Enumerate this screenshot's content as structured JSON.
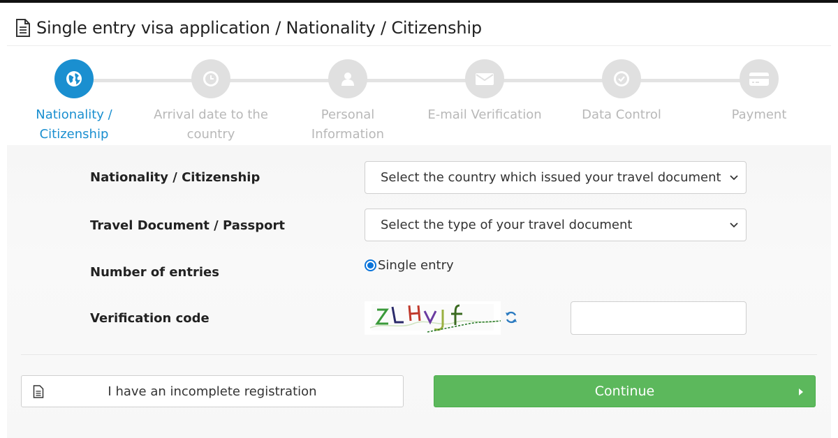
{
  "header": {
    "title": "Single entry visa application / Nationality / Citizenship",
    "icon": "document-icon"
  },
  "stepper": {
    "active_color": "#1a8fd0",
    "inactive_color": "#e0e0e0",
    "steps": [
      {
        "label": "Nationality / Citizenship",
        "icon": "globe-icon",
        "active": true
      },
      {
        "label": "Arrival date to the country",
        "icon": "clock-icon",
        "active": false
      },
      {
        "label": "Personal Information",
        "icon": "user-icon",
        "active": false
      },
      {
        "label": "E-mail Verification",
        "icon": "envelope-icon",
        "active": false
      },
      {
        "label": "Data Control",
        "icon": "check-circle-icon",
        "active": false
      },
      {
        "label": "Payment",
        "icon": "credit-card-icon",
        "active": false
      }
    ]
  },
  "form": {
    "nationality_label": "Nationality / Citizenship",
    "nationality_value": "Select the country which issued your travel document",
    "document_label": "Travel Document / Passport",
    "document_value": "Select the type of your travel document",
    "entries_label": "Number of entries",
    "entries_option": "Single entry",
    "entries_selected": true,
    "verification_label": "Verification code",
    "verification_value": ""
  },
  "actions": {
    "incomplete_label": "I have an incomplete registration",
    "continue_label": "Continue",
    "continue_color": "#5cb85c"
  }
}
